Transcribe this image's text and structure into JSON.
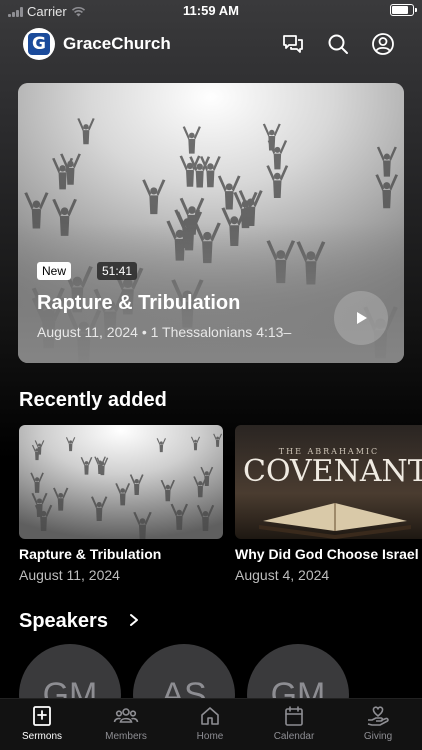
{
  "status_bar": {
    "carrier": "Carrier",
    "time": "11:59 AM",
    "battery_level": 0.85
  },
  "header": {
    "app_title": "GraceChurch",
    "logo_letter": "G"
  },
  "hero": {
    "badge": "New",
    "duration": "51:41",
    "title": "Rapture & Tribulation",
    "meta": "August 11, 2024 • 1 Thessalonians 4:13–"
  },
  "recently_added": {
    "heading": "Recently added",
    "items": [
      {
        "title": "Rapture & Tribulation",
        "date": "August 11, 2024"
      },
      {
        "title": "Why Did God Choose Israel",
        "date": "August 4, 2024",
        "art_kicker": "THE ABRAHAMIC",
        "art_title": "COVENANT"
      }
    ]
  },
  "speakers": {
    "heading": "Speakers",
    "items": [
      {
        "initials": "GM"
      },
      {
        "initials": "AS"
      },
      {
        "initials": "GM"
      }
    ]
  },
  "tabs": [
    {
      "label": "Sermons",
      "icon": "sermons-book-icon",
      "active": true
    },
    {
      "label": "Members",
      "icon": "members-group-icon",
      "active": false
    },
    {
      "label": "Home",
      "icon": "home-icon",
      "active": false
    },
    {
      "label": "Calendar",
      "icon": "calendar-icon",
      "active": false
    },
    {
      "label": "Giving",
      "icon": "giving-hand-icon",
      "active": false
    }
  ],
  "colors": {
    "background": "#000000",
    "logo_blue": "#1b4b9b",
    "tab_inactive": "#8e8e93"
  }
}
